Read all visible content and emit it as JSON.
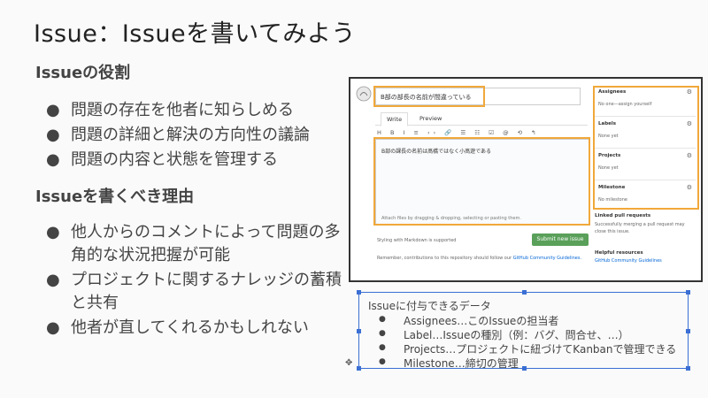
{
  "slide": {
    "title": "Issue：Issueを書いてみよう",
    "section1": {
      "heading": "Issueの役割",
      "bullets": [
        "問題の存在を他者に知らしめる",
        "問題の詳細と解決の方向性の議論",
        "問題の内容と状態を管理する"
      ]
    },
    "section2": {
      "heading": "Issueを書くべき理由",
      "bullets": [
        "他人からのコメントによって問題の多角的な状況把握が可能",
        "プロジェクトに関するナレッジの蓄積と共有",
        "他者が直してくれるかもしれない"
      ]
    },
    "bullet_glyph": "●"
  },
  "screenshot": {
    "issue_title": "B部の部長の名前が間違っている",
    "tabs": [
      "Write",
      "Preview"
    ],
    "toolbar": "H B I ≡ ‹› 🔗 ☰ ☷ ☑ @ ⟲ ↰",
    "body_text": "B部の課長の名前は髙橋ではなく小髙遊である",
    "attach_hint": "Attach files by dragging & dropping, selecting or pasting them.",
    "markdown_note": "Styling with Markdown is supported",
    "submit_label": "Submit new issue",
    "remember_text": "Remember, contributions to this repository should follow our",
    "guidelines_link": "GitHub Community Guidelines.",
    "sidebar": {
      "assignees": {
        "heading": "Assignees",
        "value": "No one—assign yourself"
      },
      "labels": {
        "heading": "Labels",
        "value": "None yet"
      },
      "projects": {
        "heading": "Projects",
        "value": "None yet"
      },
      "milestone": {
        "heading": "Milestone",
        "value": "No milestone"
      },
      "linked": {
        "heading": "Linked pull requests",
        "value": "Successfully merging a pull request may close this issue."
      },
      "helpful": {
        "heading": "Helpful resources",
        "value": "GitHub Community Guidelines"
      }
    }
  },
  "textbox": {
    "caption": "Issueに付与できるデータ",
    "items": [
      "Assignees…このIssueの担当者",
      "Label…Issueの種別（例：バグ、問合せ、…）",
      "Projects…プロジェクトに紐づけてKanbanで管理できる",
      "Milestone…締切の管理"
    ],
    "bullet_glyph": "●"
  },
  "colors": {
    "highlight": "#f0a83a",
    "selection": "#3b6fd4",
    "submit": "#5aa05a"
  }
}
